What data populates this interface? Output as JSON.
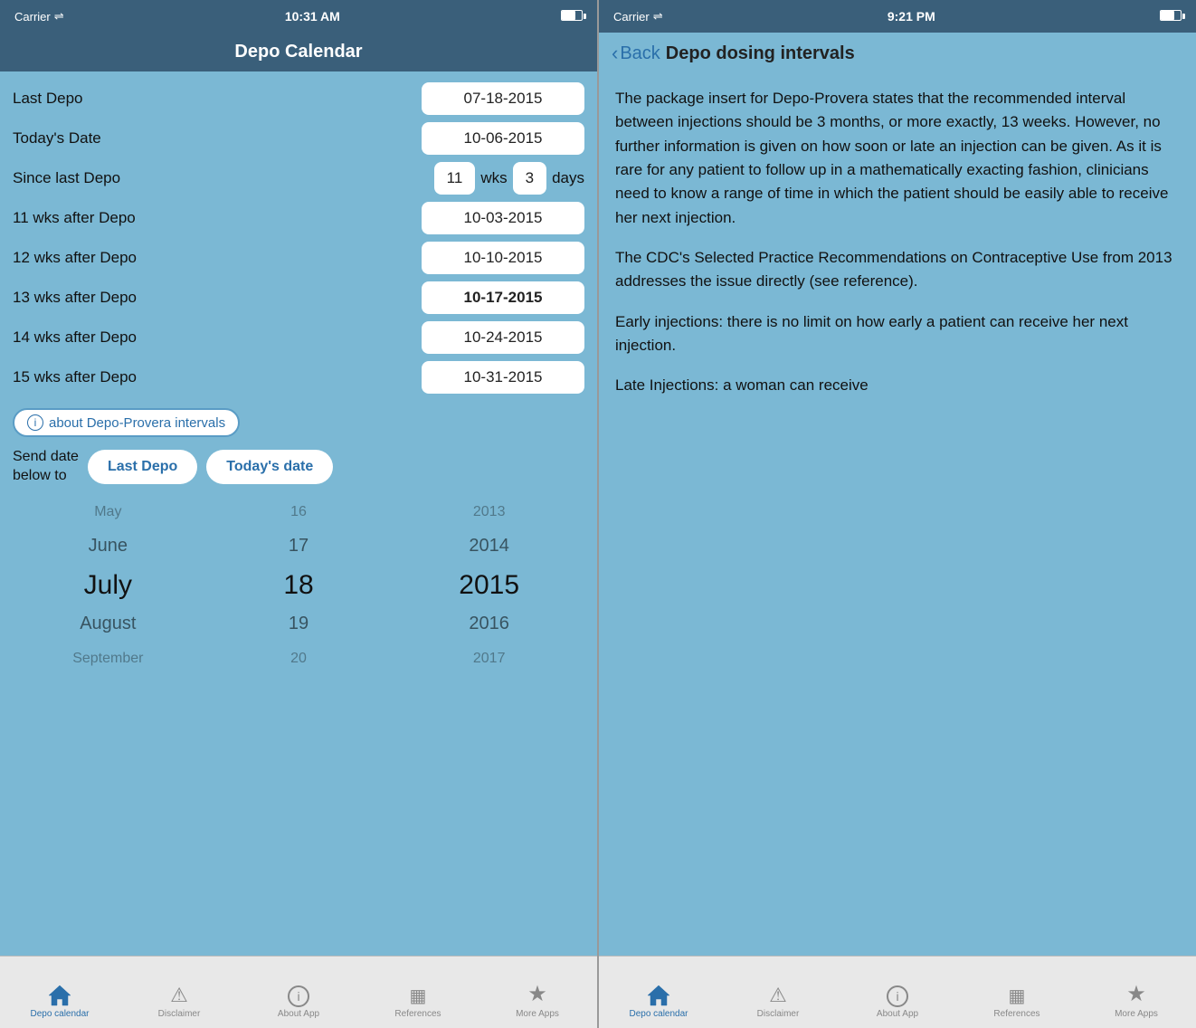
{
  "left": {
    "status": {
      "carrier": "Carrier",
      "wifi": "wifi",
      "time": "10:31 AM",
      "battery": "battery"
    },
    "header": {
      "title": "Depo Calendar"
    },
    "fields": {
      "last_depo_label": "Last Depo",
      "last_depo_value": "07-18-2015",
      "todays_date_label": "Today's Date",
      "todays_date_value": "10-06-2015",
      "since_last_label": "Since last Depo",
      "since_wks": "11",
      "since_wks_unit": "wks",
      "since_days": "3",
      "since_days_unit": "days",
      "wk11_label": "11 wks after Depo",
      "wk11_value": "10-03-2015",
      "wk12_label": "12 wks after Depo",
      "wk12_value": "10-10-2015",
      "wk13_label": "13 wks after Depo",
      "wk13_value": "10-17-2015",
      "wk14_label": "14 wks after Depo",
      "wk14_value": "10-24-2015",
      "wk15_label": "15 wks after Depo",
      "wk15_value": "10-31-2015"
    },
    "info_btn": "about Depo-Provera intervals",
    "send": {
      "label": "Send date\nbelow to",
      "btn1": "Last Depo",
      "btn2": "Today's date"
    },
    "picker": {
      "months": [
        "May",
        "June",
        "July",
        "August",
        "September"
      ],
      "days": [
        "16",
        "17",
        "18",
        "19",
        "20"
      ],
      "years": [
        "2013",
        "2014",
        "2015",
        "2016",
        "2017"
      ]
    },
    "tabs": [
      {
        "id": "depo-calendar",
        "label": "Depo calendar",
        "active": true
      },
      {
        "id": "disclaimer",
        "label": "Disclaimer",
        "active": false
      },
      {
        "id": "about-app",
        "label": "About App",
        "active": false
      },
      {
        "id": "references",
        "label": "References",
        "active": false
      },
      {
        "id": "more-apps",
        "label": "More Apps",
        "active": false
      }
    ]
  },
  "right": {
    "status": {
      "carrier": "Carrier",
      "wifi": "wifi",
      "time": "9:21 PM",
      "battery": "battery"
    },
    "header": {
      "back_label": "Back",
      "title": "Depo dosing intervals"
    },
    "paragraphs": [
      "The package insert for Depo-Provera states that the recommended interval between injections should be 3 months, or more exactly, 13 weeks. However, no further information is given on how soon or late an injection can be given.  As it is rare for any patient to follow up in a mathematically exacting fashion, clinicians need to know a range of time in which the patient should be easily able to receive her next injection.",
      "The CDC's Selected Practice Recommendations on Contraceptive Use from 2013 addresses the issue directly (see reference).",
      "Early injections:  there is no limit on how early a patient can receive her next injection.",
      "Late Injections:  a woman can receive"
    ],
    "tabs": [
      {
        "id": "depo-calendar",
        "label": "Depo calendar",
        "active": true
      },
      {
        "id": "disclaimer",
        "label": "Disclaimer",
        "active": false
      },
      {
        "id": "about-app",
        "label": "About App",
        "active": false
      },
      {
        "id": "references",
        "label": "References",
        "active": false
      },
      {
        "id": "more-apps",
        "label": "More Apps",
        "active": false
      }
    ]
  }
}
